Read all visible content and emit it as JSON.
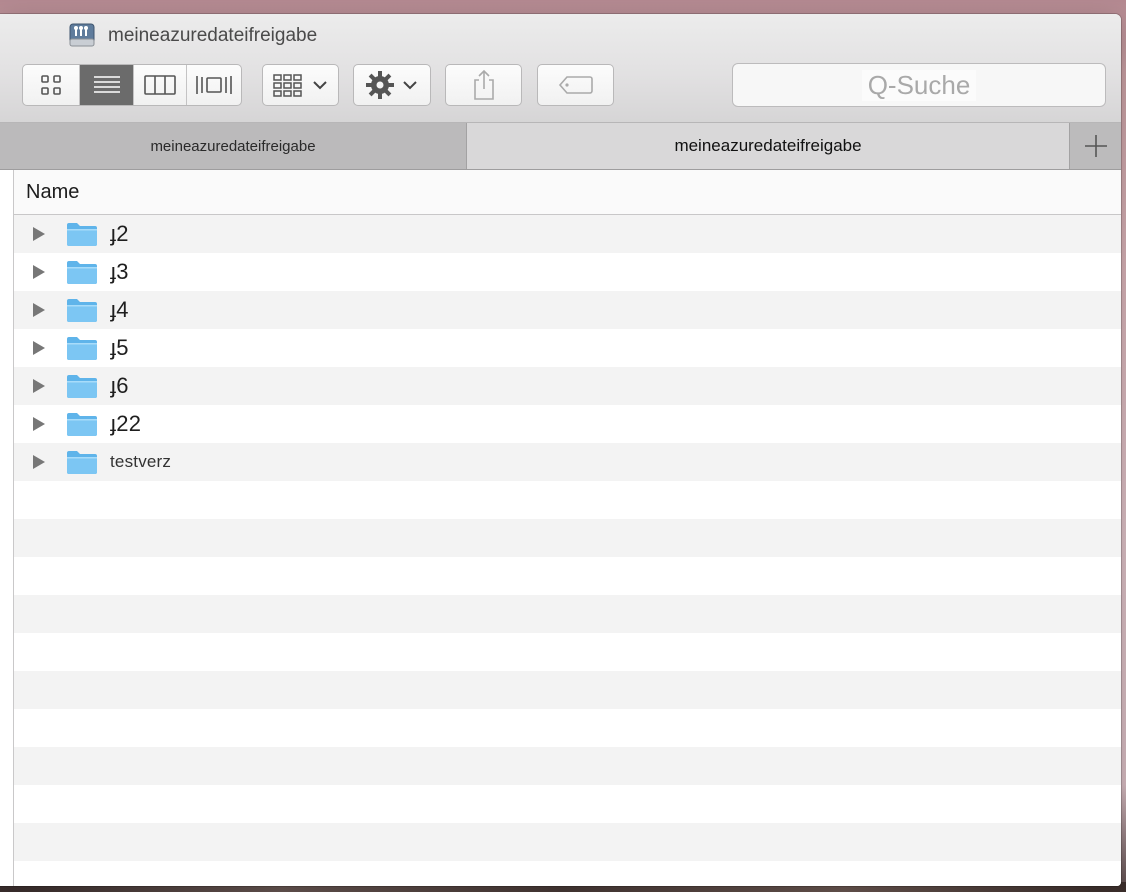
{
  "window": {
    "title": "meineazuredateifreigabe"
  },
  "toolbar": {
    "view_buttons": [
      "icon-view",
      "list-view",
      "column-view",
      "coverflow-view"
    ],
    "active_view": "list-view",
    "group_button": "group-icon",
    "action_button": "gear-icon",
    "share_button": "share-icon",
    "tag_button": "tag-icon",
    "search_placeholder": "Q-Suche"
  },
  "tabs": [
    {
      "label": "meineazuredateifreigabe",
      "active": false
    },
    {
      "label": "meineazuredateifreigabe",
      "active": true
    }
  ],
  "tab_add_icon": "plus-icon",
  "list": {
    "column_header": "Name",
    "items": [
      {
        "name": "ɟ2",
        "icon": "folder-icon"
      },
      {
        "name": "ɟ3",
        "icon": "folder-icon"
      },
      {
        "name": "ɟ4",
        "icon": "folder-icon"
      },
      {
        "name": "ɟ5",
        "icon": "folder-icon"
      },
      {
        "name": "ɟ6",
        "icon": "folder-icon"
      },
      {
        "name": "ɟ22",
        "icon": "folder-icon"
      },
      {
        "name": "testverz",
        "icon": "folder-icon"
      }
    ]
  },
  "colors": {
    "folder": "#7cc6f3",
    "active_segment": "#6b6b6b",
    "toolbar": "#e2e1e2",
    "tabbar": "#bdbcbd"
  }
}
